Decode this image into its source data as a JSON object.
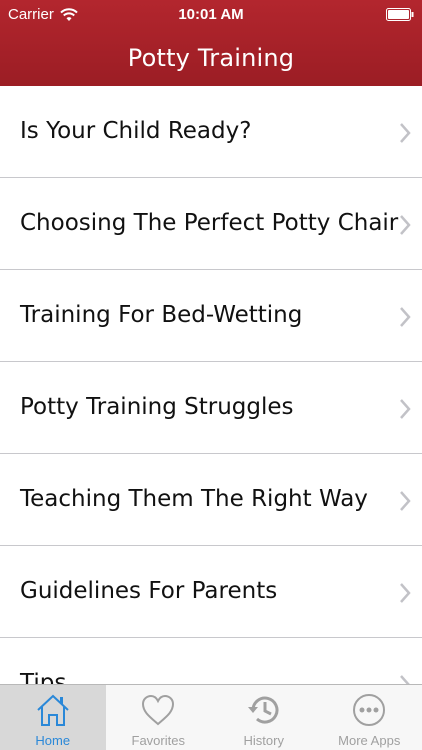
{
  "status_bar": {
    "carrier": "Carrier",
    "time": "10:01 AM"
  },
  "nav": {
    "title": "Potty Training"
  },
  "list": {
    "items": [
      {
        "label": "Is Your Child Ready?"
      },
      {
        "label": "Choosing The Perfect Potty Chair"
      },
      {
        "label": "Training For Bed-Wetting"
      },
      {
        "label": "Potty Training Struggles"
      },
      {
        "label": "Teaching Them The Right Way"
      },
      {
        "label": "Guidelines For Parents"
      },
      {
        "label": "Tips"
      }
    ]
  },
  "tabbar": {
    "tabs": [
      {
        "label": "Home",
        "icon": "home-icon",
        "active": true
      },
      {
        "label": "Favorites",
        "icon": "heart-icon",
        "active": false
      },
      {
        "label": "History",
        "icon": "history-icon",
        "active": false
      },
      {
        "label": "More Apps",
        "icon": "more-icon",
        "active": false
      }
    ]
  },
  "colors": {
    "header": "#a8222a",
    "active_tab": "#2a88d8",
    "inactive_tab": "#a0a0a0"
  }
}
